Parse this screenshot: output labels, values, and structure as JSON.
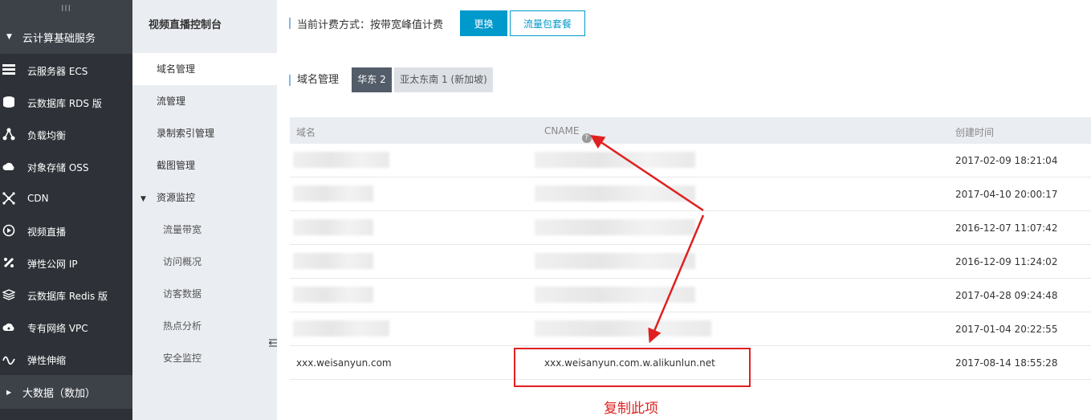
{
  "left_nav": {
    "grip": "III",
    "group_label": "云计算基础服务",
    "items": [
      {
        "label": "云服务器 ECS",
        "icon": "server-icon"
      },
      {
        "label": "云数据库 RDS 版",
        "icon": "database-icon"
      },
      {
        "label": "负载均衡",
        "icon": "load-balance-icon"
      },
      {
        "label": "对象存储 OSS",
        "icon": "cloud-storage-icon"
      },
      {
        "label": "CDN",
        "icon": "cdn-icon"
      },
      {
        "label": "视频直播",
        "icon": "live-video-icon"
      },
      {
        "label": "弹性公网 IP",
        "icon": "elastic-ip-icon"
      },
      {
        "label": "云数据库 Redis 版",
        "icon": "redis-icon"
      },
      {
        "label": "专有网络 VPC",
        "icon": "vpc-icon"
      },
      {
        "label": "弹性伸缩",
        "icon": "autoscale-icon"
      }
    ],
    "group2_label": "大数据（数加）"
  },
  "sub_nav": {
    "title": "视频直播控制台",
    "items": [
      "域名管理",
      "流管理",
      "录制索引管理",
      "截图管理"
    ],
    "group_label": "资源监控",
    "children": [
      "流量带宽",
      "访问概况",
      "访客数据",
      "热点分析",
      "安全监控"
    ]
  },
  "billing": {
    "text": "当前计费方式：按带宽峰值计费",
    "change_label": "更换",
    "package_label": "流量包套餐"
  },
  "domains": {
    "label": "域名管理",
    "regions": [
      "华东 2",
      "亚太东南 1 (新加坡)"
    ]
  },
  "table": {
    "headers": {
      "domain": "域名",
      "cname": "CNAME",
      "created": "创建时间"
    },
    "rows": [
      {
        "domain": "",
        "cname": "",
        "created": "2017-02-09 18:21:04"
      },
      {
        "domain": "",
        "cname": "",
        "created": "2017-04-10 20:00:17"
      },
      {
        "domain": "",
        "cname": "",
        "created": "2016-12-07 11:07:42"
      },
      {
        "domain": "",
        "cname": "",
        "created": "2016-12-09 11:24:02"
      },
      {
        "domain": "",
        "cname": "",
        "created": "2017-04-28 09:24:48"
      },
      {
        "domain": "",
        "cname": "",
        "created": "2017-01-04 20:22:55"
      },
      {
        "domain": "xxx.weisanyun.com",
        "cname": "xxx.weisanyun.com.w.alikunlun.net",
        "created": "2017-08-14 18:55:28"
      }
    ]
  },
  "annotation": {
    "copy_hint": "复制此项",
    "color": "#e02020"
  }
}
